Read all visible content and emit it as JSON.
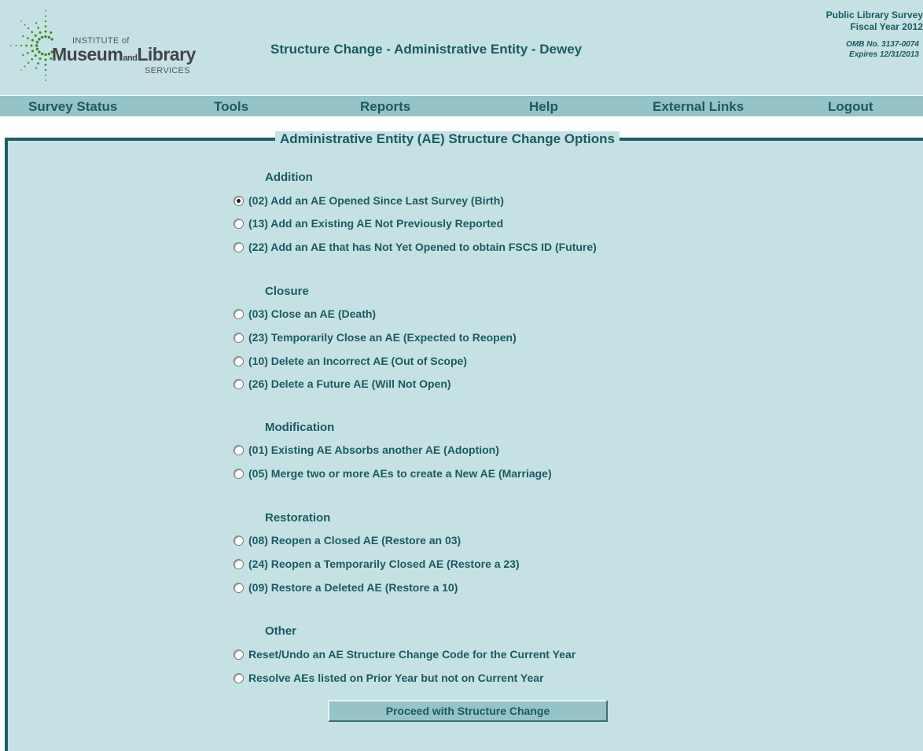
{
  "header": {
    "logo": {
      "institute": "INSTITUTE of",
      "museum": "Museum",
      "and": "and",
      "library": "Library",
      "services": "SERVICES"
    },
    "title": "Structure Change - Administrative Entity - Dewey",
    "survey_name": "Public Library Survey",
    "fiscal_year": "Fiscal Year 2012",
    "omb": "OMB No. 3137-0074",
    "expires": "Expires 12/31/2013"
  },
  "nav": {
    "items": [
      {
        "label": "Survey Status"
      },
      {
        "label": "Tools"
      },
      {
        "label": "Reports"
      },
      {
        "label": "Help"
      },
      {
        "label": "External Links"
      },
      {
        "label": "Logout"
      }
    ]
  },
  "panel": {
    "legend": "Administrative Entity (AE) Structure Change Options",
    "sections": [
      {
        "title": "Addition",
        "options": [
          {
            "label": "(02) Add an AE Opened Since Last Survey (Birth)",
            "checked": true
          },
          {
            "label": "(13) Add an Existing AE Not Previously Reported",
            "checked": false
          },
          {
            "label": "(22) Add an AE that has Not Yet Opened to obtain FSCS ID (Future)",
            "checked": false
          }
        ]
      },
      {
        "title": "Closure",
        "options": [
          {
            "label": "(03) Close an AE (Death)",
            "checked": false
          },
          {
            "label": "(23) Temporarily Close an AE (Expected to Reopen)",
            "checked": false
          },
          {
            "label": "(10) Delete an Incorrect AE (Out of Scope)",
            "checked": false
          },
          {
            "label": "(26) Delete a Future AE (Will Not Open)",
            "checked": false
          }
        ]
      },
      {
        "title": "Modification",
        "options": [
          {
            "label": "(01) Existing AE Absorbs another AE (Adoption)",
            "checked": false
          },
          {
            "label": "(05) Merge two or more AEs to create a New AE (Marriage)",
            "checked": false
          }
        ]
      },
      {
        "title": "Restoration",
        "options": [
          {
            "label": "(08) Reopen a Closed AE (Restore an 03)",
            "checked": false
          },
          {
            "label": "(24) Reopen a Temporarily Closed AE (Restore a 23)",
            "checked": false
          },
          {
            "label": "(09) Restore a Deleted AE (Restore a 10)",
            "checked": false
          }
        ]
      },
      {
        "title": "Other",
        "options": [
          {
            "label": "Reset/Undo an AE Structure Change Code for the Current Year",
            "checked": false
          },
          {
            "label": "Resolve AEs listed on Prior Year but not on Current Year",
            "checked": false
          }
        ]
      }
    ],
    "proceed_label": "Proceed with Structure Change"
  },
  "colors": {
    "header_bg": "#c6e1e3",
    "nav_bg": "#96c3c7",
    "text": "#1b5a63",
    "border": "#1e5f67",
    "logo_dots": "#3f8a2e"
  }
}
